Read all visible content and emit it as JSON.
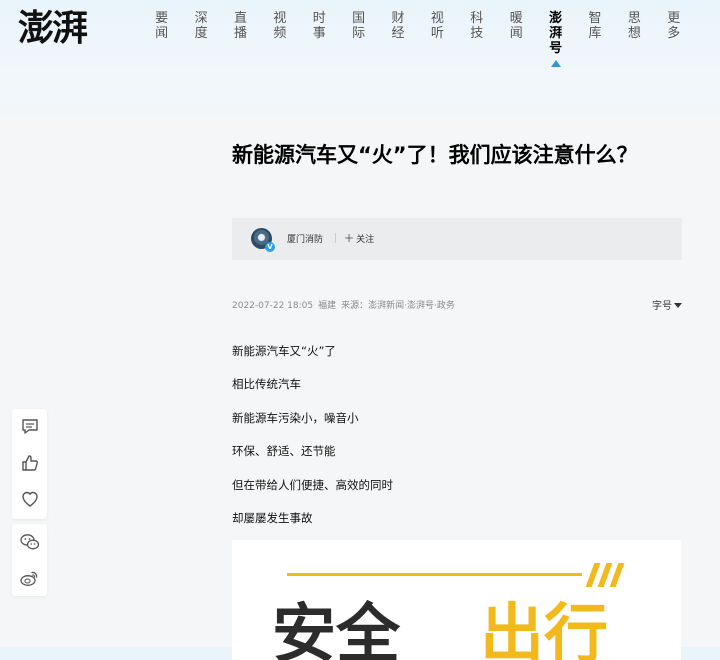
{
  "logo": "澎湃",
  "nav": [
    {
      "label": "要闻",
      "active": false
    },
    {
      "label": "深度",
      "active": false
    },
    {
      "label": "直播",
      "active": false
    },
    {
      "label": "视频",
      "active": false
    },
    {
      "label": "时事",
      "active": false
    },
    {
      "label": "国际",
      "active": false
    },
    {
      "label": "财经",
      "active": false
    },
    {
      "label": "视听",
      "active": false
    },
    {
      "label": "科技",
      "active": false
    },
    {
      "label": "暖闻",
      "active": false
    },
    {
      "label": "澎湃号",
      "active": true
    },
    {
      "label": "智库",
      "active": false
    },
    {
      "label": "思想",
      "active": false
    },
    {
      "label": "更多",
      "active": false
    }
  ],
  "article": {
    "title": "新能源汽车又“火”了！我们应该注意什么？",
    "author": {
      "name": "厦门消防",
      "verified_badge": "V",
      "follow_label": "关注",
      "follow_plus": "+"
    },
    "meta": {
      "date": "2022-07-22 18:05",
      "location": "福建",
      "source": "来源：澎湃新闻·澎湃号·政务"
    },
    "font_size_label": "字号",
    "paragraphs": [
      "新能源汽车又“火”了",
      "相比传统汽车",
      "新能源车污染小，噪音小",
      "环保、舒适、还节能",
      "但在带给人们便捷、高效的同时",
      "却屡屡发生事故"
    ],
    "banner": {
      "text_dark": "安全",
      "text_accent": "出行"
    }
  },
  "sidebar_icons": [
    "comment-icon",
    "like-icon",
    "favorite-heart-icon",
    "wechat-icon",
    "weibo-icon"
  ],
  "colors": {
    "accent_blue": "#2f98d0",
    "banner_yellow": "#f2b91c",
    "banner_dark": "#2c2c2c"
  }
}
